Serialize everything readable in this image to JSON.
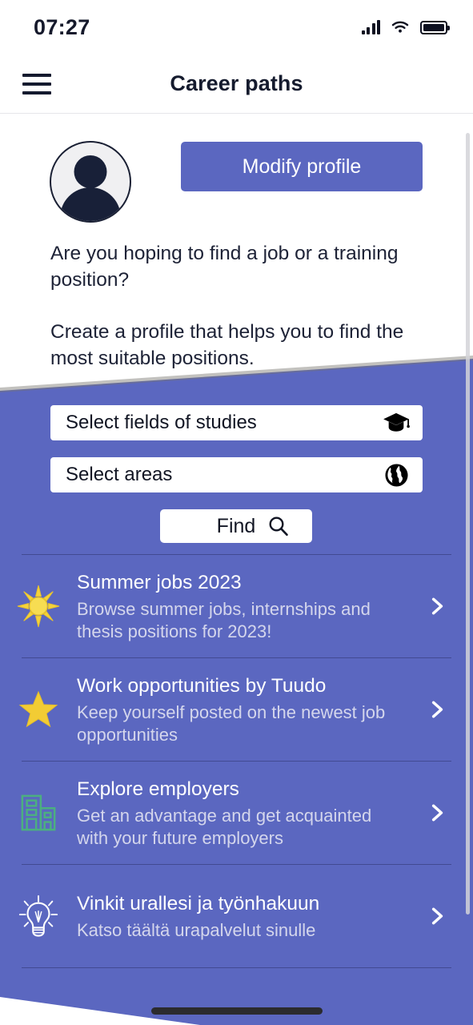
{
  "status_bar": {
    "time": "07:27",
    "icons": [
      "signal-icon",
      "wifi-icon",
      "battery-icon"
    ]
  },
  "nav": {
    "menu_icon": "hamburger-menu-icon",
    "title": "Career paths"
  },
  "profile": {
    "avatar_icon": "user-avatar-icon",
    "modify_button_label": "Modify profile",
    "intro_line_1": "Are you hoping to find a job or a training position?",
    "intro_line_2": "Create a profile that helps you to find the most suitable positions."
  },
  "search": {
    "fields_placeholder": "Select fields of studies",
    "fields_icon": "graduation-cap-icon",
    "areas_placeholder": "Select areas",
    "areas_icon": "globe-icon",
    "find_label": "Find",
    "find_icon": "search-icon"
  },
  "list": [
    {
      "icon": "sun-icon",
      "title": "Summer jobs 2023",
      "subtitle": "Browse summer jobs, internships and thesis positions for 2023!",
      "chevron": "chevron-right-icon"
    },
    {
      "icon": "star-icon",
      "title": "Work opportunities by Tuudo",
      "subtitle": "Keep yourself posted on the newest job opportunities",
      "chevron": "chevron-right-icon"
    },
    {
      "icon": "building-icon",
      "title": "Explore employers",
      "subtitle": "Get an advantage and get acquainted with your future employers",
      "chevron": "chevron-right-icon"
    },
    {
      "icon": "lightbulb-icon",
      "title": "Vinkit urallesi ja työnhakuun",
      "subtitle": "Katso täältä urapalvelut sinulle",
      "chevron": "chevron-right-icon"
    }
  ],
  "colors": {
    "accent_purple": "#5b67c0",
    "dark_navy": "#151b2e",
    "sun_yellow": "#f5d33b",
    "star_yellow": "#f2cc34",
    "building_green": "#4caf80",
    "subtitle_text": "#d4d6ec"
  }
}
